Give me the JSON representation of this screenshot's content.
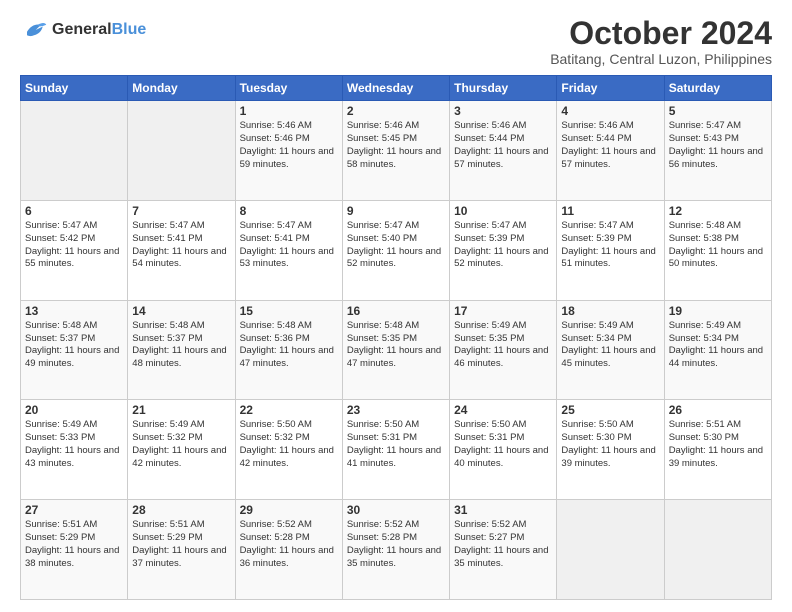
{
  "logo": {
    "line1": "General",
    "line2": "Blue"
  },
  "title": "October 2024",
  "location": "Batitang, Central Luzon, Philippines",
  "days_header": [
    "Sunday",
    "Monday",
    "Tuesday",
    "Wednesday",
    "Thursday",
    "Friday",
    "Saturday"
  ],
  "weeks": [
    [
      {
        "day": "",
        "empty": true
      },
      {
        "day": "",
        "empty": true
      },
      {
        "day": "1",
        "sunrise": "Sunrise: 5:46 AM",
        "sunset": "Sunset: 5:46 PM",
        "daylight": "Daylight: 11 hours and 59 minutes."
      },
      {
        "day": "2",
        "sunrise": "Sunrise: 5:46 AM",
        "sunset": "Sunset: 5:45 PM",
        "daylight": "Daylight: 11 hours and 58 minutes."
      },
      {
        "day": "3",
        "sunrise": "Sunrise: 5:46 AM",
        "sunset": "Sunset: 5:44 PM",
        "daylight": "Daylight: 11 hours and 57 minutes."
      },
      {
        "day": "4",
        "sunrise": "Sunrise: 5:46 AM",
        "sunset": "Sunset: 5:44 PM",
        "daylight": "Daylight: 11 hours and 57 minutes."
      },
      {
        "day": "5",
        "sunrise": "Sunrise: 5:47 AM",
        "sunset": "Sunset: 5:43 PM",
        "daylight": "Daylight: 11 hours and 56 minutes."
      }
    ],
    [
      {
        "day": "6",
        "sunrise": "Sunrise: 5:47 AM",
        "sunset": "Sunset: 5:42 PM",
        "daylight": "Daylight: 11 hours and 55 minutes."
      },
      {
        "day": "7",
        "sunrise": "Sunrise: 5:47 AM",
        "sunset": "Sunset: 5:41 PM",
        "daylight": "Daylight: 11 hours and 54 minutes."
      },
      {
        "day": "8",
        "sunrise": "Sunrise: 5:47 AM",
        "sunset": "Sunset: 5:41 PM",
        "daylight": "Daylight: 11 hours and 53 minutes."
      },
      {
        "day": "9",
        "sunrise": "Sunrise: 5:47 AM",
        "sunset": "Sunset: 5:40 PM",
        "daylight": "Daylight: 11 hours and 52 minutes."
      },
      {
        "day": "10",
        "sunrise": "Sunrise: 5:47 AM",
        "sunset": "Sunset: 5:39 PM",
        "daylight": "Daylight: 11 hours and 52 minutes."
      },
      {
        "day": "11",
        "sunrise": "Sunrise: 5:47 AM",
        "sunset": "Sunset: 5:39 PM",
        "daylight": "Daylight: 11 hours and 51 minutes."
      },
      {
        "day": "12",
        "sunrise": "Sunrise: 5:48 AM",
        "sunset": "Sunset: 5:38 PM",
        "daylight": "Daylight: 11 hours and 50 minutes."
      }
    ],
    [
      {
        "day": "13",
        "sunrise": "Sunrise: 5:48 AM",
        "sunset": "Sunset: 5:37 PM",
        "daylight": "Daylight: 11 hours and 49 minutes."
      },
      {
        "day": "14",
        "sunrise": "Sunrise: 5:48 AM",
        "sunset": "Sunset: 5:37 PM",
        "daylight": "Daylight: 11 hours and 48 minutes."
      },
      {
        "day": "15",
        "sunrise": "Sunrise: 5:48 AM",
        "sunset": "Sunset: 5:36 PM",
        "daylight": "Daylight: 11 hours and 47 minutes."
      },
      {
        "day": "16",
        "sunrise": "Sunrise: 5:48 AM",
        "sunset": "Sunset: 5:35 PM",
        "daylight": "Daylight: 11 hours and 47 minutes."
      },
      {
        "day": "17",
        "sunrise": "Sunrise: 5:49 AM",
        "sunset": "Sunset: 5:35 PM",
        "daylight": "Daylight: 11 hours and 46 minutes."
      },
      {
        "day": "18",
        "sunrise": "Sunrise: 5:49 AM",
        "sunset": "Sunset: 5:34 PM",
        "daylight": "Daylight: 11 hours and 45 minutes."
      },
      {
        "day": "19",
        "sunrise": "Sunrise: 5:49 AM",
        "sunset": "Sunset: 5:34 PM",
        "daylight": "Daylight: 11 hours and 44 minutes."
      }
    ],
    [
      {
        "day": "20",
        "sunrise": "Sunrise: 5:49 AM",
        "sunset": "Sunset: 5:33 PM",
        "daylight": "Daylight: 11 hours and 43 minutes."
      },
      {
        "day": "21",
        "sunrise": "Sunrise: 5:49 AM",
        "sunset": "Sunset: 5:32 PM",
        "daylight": "Daylight: 11 hours and 42 minutes."
      },
      {
        "day": "22",
        "sunrise": "Sunrise: 5:50 AM",
        "sunset": "Sunset: 5:32 PM",
        "daylight": "Daylight: 11 hours and 42 minutes."
      },
      {
        "day": "23",
        "sunrise": "Sunrise: 5:50 AM",
        "sunset": "Sunset: 5:31 PM",
        "daylight": "Daylight: 11 hours and 41 minutes."
      },
      {
        "day": "24",
        "sunrise": "Sunrise: 5:50 AM",
        "sunset": "Sunset: 5:31 PM",
        "daylight": "Daylight: 11 hours and 40 minutes."
      },
      {
        "day": "25",
        "sunrise": "Sunrise: 5:50 AM",
        "sunset": "Sunset: 5:30 PM",
        "daylight": "Daylight: 11 hours and 39 minutes."
      },
      {
        "day": "26",
        "sunrise": "Sunrise: 5:51 AM",
        "sunset": "Sunset: 5:30 PM",
        "daylight": "Daylight: 11 hours and 39 minutes."
      }
    ],
    [
      {
        "day": "27",
        "sunrise": "Sunrise: 5:51 AM",
        "sunset": "Sunset: 5:29 PM",
        "daylight": "Daylight: 11 hours and 38 minutes."
      },
      {
        "day": "28",
        "sunrise": "Sunrise: 5:51 AM",
        "sunset": "Sunset: 5:29 PM",
        "daylight": "Daylight: 11 hours and 37 minutes."
      },
      {
        "day": "29",
        "sunrise": "Sunrise: 5:52 AM",
        "sunset": "Sunset: 5:28 PM",
        "daylight": "Daylight: 11 hours and 36 minutes."
      },
      {
        "day": "30",
        "sunrise": "Sunrise: 5:52 AM",
        "sunset": "Sunset: 5:28 PM",
        "daylight": "Daylight: 11 hours and 35 minutes."
      },
      {
        "day": "31",
        "sunrise": "Sunrise: 5:52 AM",
        "sunset": "Sunset: 5:27 PM",
        "daylight": "Daylight: 11 hours and 35 minutes."
      },
      {
        "day": "",
        "empty": true
      },
      {
        "day": "",
        "empty": true
      }
    ]
  ]
}
